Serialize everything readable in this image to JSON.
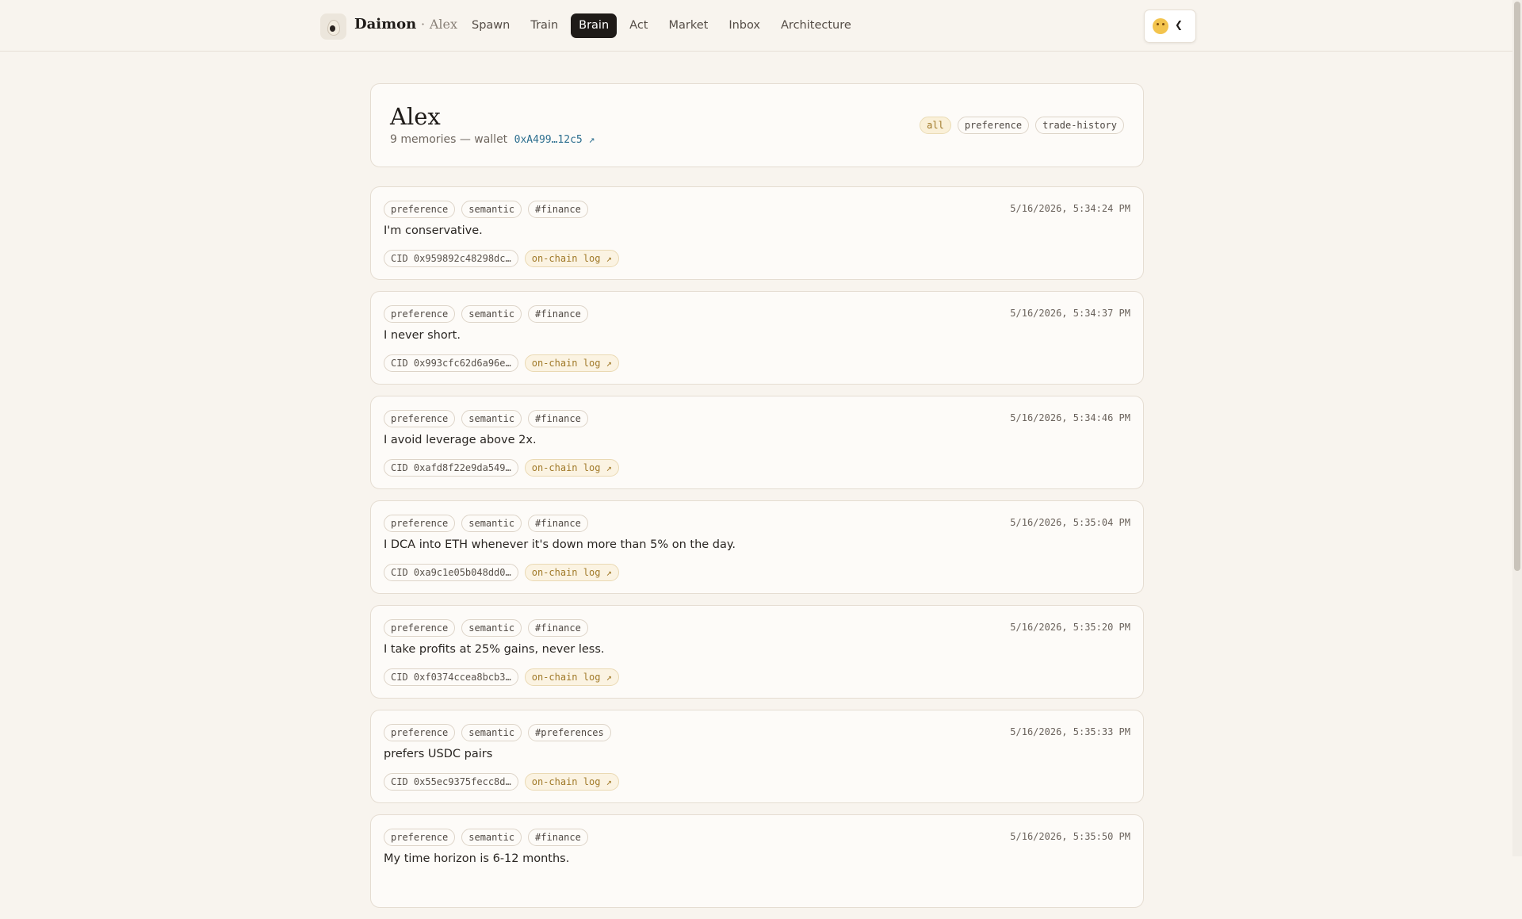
{
  "nav": {
    "brand": "Daimon",
    "separator": "·",
    "user": "Alex",
    "items": [
      {
        "label": "Spawn",
        "active": false
      },
      {
        "label": "Train",
        "active": false
      },
      {
        "label": "Brain",
        "active": true
      },
      {
        "label": "Act",
        "active": false
      },
      {
        "label": "Market",
        "active": false
      },
      {
        "label": "Inbox",
        "active": false
      },
      {
        "label": "Architecture",
        "active": false
      }
    ],
    "logo_icon": "egg-eye-icon",
    "account_icon": "chick-avatar-icon",
    "account_chevron": "chevron-down-icon"
  },
  "profile": {
    "name": "Alex",
    "summary": "9 memories — wallet",
    "wallet": "0xA499…12c5 ↗",
    "filters": [
      {
        "label": "all",
        "active": true
      },
      {
        "label": "preference",
        "active": false
      },
      {
        "label": "trade-history",
        "active": false
      }
    ]
  },
  "memories": [
    {
      "tags": [
        "preference",
        "semantic",
        "#finance"
      ],
      "timestamp": "5/16/2026, 5:34:24 PM",
      "text": "I'm conservative.",
      "cid": "CID 0x959892c48298dc…",
      "log": "on-chain log ↗"
    },
    {
      "tags": [
        "preference",
        "semantic",
        "#finance"
      ],
      "timestamp": "5/16/2026, 5:34:37 PM",
      "text": "I never short.",
      "cid": "CID 0x993cfc62d6a96e…",
      "log": "on-chain log ↗"
    },
    {
      "tags": [
        "preference",
        "semantic",
        "#finance"
      ],
      "timestamp": "5/16/2026, 5:34:46 PM",
      "text": "I avoid leverage above 2x.",
      "cid": "CID 0xafd8f22e9da549…",
      "log": "on-chain log ↗"
    },
    {
      "tags": [
        "preference",
        "semantic",
        "#finance"
      ],
      "timestamp": "5/16/2026, 5:35:04 PM",
      "text": "I DCA into ETH whenever it's down more than 5% on the day.",
      "cid": "CID 0xa9c1e05b048dd0…",
      "log": "on-chain log ↗"
    },
    {
      "tags": [
        "preference",
        "semantic",
        "#finance"
      ],
      "timestamp": "5/16/2026, 5:35:20 PM",
      "text": "I take profits at 25% gains, never less.",
      "cid": "CID 0xf0374ccea8bcb3…",
      "log": "on-chain log ↗"
    },
    {
      "tags": [
        "preference",
        "semantic",
        "#preferences"
      ],
      "timestamp": "5/16/2026, 5:35:33 PM",
      "text": "prefers USDC pairs",
      "cid": "CID 0x55ec9375fecc8d…",
      "log": "on-chain log ↗"
    },
    {
      "tags": [
        "preference",
        "semantic",
        "#finance"
      ],
      "timestamp": "5/16/2026, 5:35:50 PM",
      "text": "My time horizon is 6-12 months.",
      "cid": "",
      "log": ""
    }
  ]
}
